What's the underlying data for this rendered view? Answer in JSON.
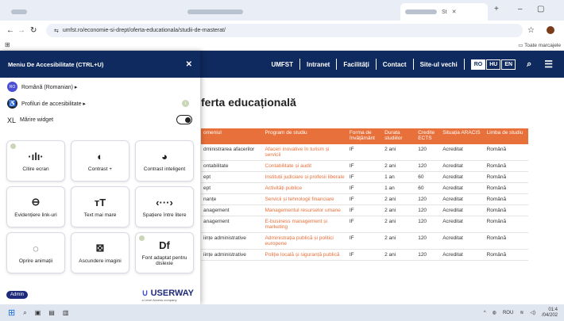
{
  "browser": {
    "active_tab_label": "St",
    "url": "umfst.ro/economie-si-drept/oferta-educationala/studii-de-masterat/",
    "bookmark_label": "Toate marcajele"
  },
  "site_nav": {
    "items": [
      "UMFST",
      "Intranet",
      "Facilități",
      "Contact",
      "Site-ul vechi"
    ],
    "languages": [
      "RO",
      "HU",
      "EN"
    ],
    "selected_language": "RO"
  },
  "page": {
    "title": "ferta educațională",
    "table": {
      "headers": [
        "omeniul",
        "Program de studiu",
        "Forma de învățământ",
        "Durata studiilor",
        "Credite ECTS",
        "Situația ARACIS",
        "Limba de studiu"
      ],
      "rows": [
        [
          "dministrarea afacerilor",
          "Afaceri inovative în turism și servicii",
          "IF",
          "2 ani",
          "120",
          "Acreditat",
          "Română"
        ],
        [
          "ontabilitate",
          "Contabilitate și audit",
          "IF",
          "2 ani",
          "120",
          "Acreditat",
          "Română"
        ],
        [
          "ept",
          "Instituții judiciare și profesii liberale",
          "IF",
          "1 an",
          "60",
          "Acreditat",
          "Română"
        ],
        [
          "ept",
          "Activități publice",
          "IF",
          "1 an",
          "60",
          "Acreditat",
          "Română"
        ],
        [
          "nanțe",
          "Servicii și tehnologii financiare",
          "IF",
          "2 ani",
          "120",
          "Acreditat",
          "Română"
        ],
        [
          "anagement",
          "Managementul resurselor umane",
          "IF",
          "2 ani",
          "120",
          "Acreditat",
          "Română"
        ],
        [
          "anagement",
          "E-business management și marketing",
          "IF",
          "2 ani",
          "120",
          "Acreditat",
          "Română"
        ],
        [
          "iințe administrative",
          "Administrația publică și politici europene",
          "IF",
          "2 ani",
          "120",
          "Acreditat",
          "Română"
        ],
        [
          "iințe administrative",
          "Poliție locală și siguranță publică",
          "IF",
          "2 ani",
          "120",
          "Acreditat",
          "Română"
        ]
      ]
    }
  },
  "accessibility_panel": {
    "title": "Meniu De Accesibilitate (CTRL+U)",
    "language": {
      "badge": "RO",
      "label": "Română (Romanian) ▸"
    },
    "profiles_label": "Profiluri de accesibilitate ▸",
    "oversize_prefix": "XL",
    "oversize_label": "Mărire widget",
    "cards": [
      {
        "icon": "·ılı·",
        "label": "Citire ecran",
        "name": "screen-reader-icon"
      },
      {
        "icon": "◐",
        "label": "Contrast +",
        "name": "contrast-icon"
      },
      {
        "icon": "◕",
        "label": "Contrast inteligent",
        "name": "smart-contrast-icon"
      },
      {
        "icon": "⊖",
        "label": "Evidențiere link-uri",
        "name": "link-icon"
      },
      {
        "icon": "тT",
        "label": "Text mai mare",
        "name": "text-size-icon"
      },
      {
        "icon": "‹···›",
        "label": "Spațiere între litere",
        "name": "spacing-icon"
      },
      {
        "icon": "◌",
        "label": "Oprire animații",
        "name": "pause-animation-icon"
      },
      {
        "icon": "⊠",
        "label": "Ascundere imagini",
        "name": "hide-images-icon"
      },
      {
        "icon": "Df",
        "label": "Font adaptat pentru dislexie",
        "name": "dyslexia-font-icon"
      }
    ],
    "admin_label": "Admin",
    "brand": "USERWAY",
    "brand_sub": "a Level Access company"
  },
  "taskbar": {
    "lang": "ROU",
    "time": "01:4",
    "date": "/04/202"
  }
}
